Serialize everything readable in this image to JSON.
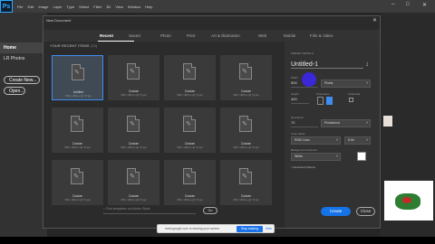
{
  "app": {
    "logo": "Ps",
    "menu": [
      "File",
      "Edit",
      "Image",
      "Layer",
      "Type",
      "Select",
      "Filter",
      "3D",
      "View",
      "Window",
      "Help"
    ]
  },
  "left_panel": {
    "items": [
      "Home",
      "LR Photos"
    ],
    "buttons": [
      "Create New...",
      "Open..."
    ]
  },
  "dialog": {
    "title": "New Document",
    "tabs": [
      "Recent",
      "Saved",
      "Photo",
      "Print",
      "Art & Illustration",
      "Web",
      "Mobile",
      "Film & Video"
    ],
    "section_label": "YOUR RECENT ITEMS",
    "section_count": "(15)",
    "tiles": [
      {
        "name": "Untitled",
        "meta": "500 x 400 px @ 72 ppi"
      },
      {
        "name": "Custom",
        "meta": "500 x 400 px @ 72 ppi"
      },
      {
        "name": "Custom",
        "meta": "500 x 400 px @ 72 ppi"
      },
      {
        "name": "Custom",
        "meta": "500 x 400 px @ 72 ppi"
      },
      {
        "name": "Custom",
        "meta": "500 x 400 px @ 72 ppi"
      },
      {
        "name": "Custom",
        "meta": "500 x 400 px @ 72 ppi"
      },
      {
        "name": "Custom",
        "meta": "500 x 400 px @ 72 ppi"
      },
      {
        "name": "Custom",
        "meta": "500 x 400 px @ 72 ppi"
      },
      {
        "name": "Custom",
        "meta": "500 x 400 px @ 72 ppi"
      },
      {
        "name": "Custom",
        "meta": "500 x 400 px @ 72 ppi"
      },
      {
        "name": "Custom",
        "meta": "500 x 400 px @ 72 ppi"
      },
      {
        "name": "Custom",
        "meta": "500 x 400 px @ 72 ppi"
      }
    ],
    "search_placeholder": "Find templates on Adobe Stock",
    "go_label": "Go",
    "create_label": "Create",
    "close_label": "Close"
  },
  "preset": {
    "section": "PRESET DETAILS",
    "name": "Untitled-1",
    "width_label": "Width",
    "width_value": "500",
    "width_unit": "Pixels",
    "height_label": "Height",
    "height_value": "400",
    "orientation_label": "Orientation",
    "artboards_label": "Artboards",
    "resolution_label": "Resolution",
    "resolution_value": "72",
    "resolution_unit": "Pixels/Inch",
    "color_mode_label": "Color Mode",
    "color_mode_value": "RGB Color",
    "bit_depth": "8 bit",
    "background_label": "Background Contents",
    "background_value": "White",
    "advanced_label": "> Advanced Options"
  },
  "share_bar": {
    "text": "meet.google.com is sharing your screen.",
    "stop_label": "Stop sharing",
    "hide_label": "Hide"
  },
  "colors": {
    "accent": "#1473e6",
    "selected_border": "#3e8df0",
    "dialog_bg": "#2b2b2b"
  }
}
